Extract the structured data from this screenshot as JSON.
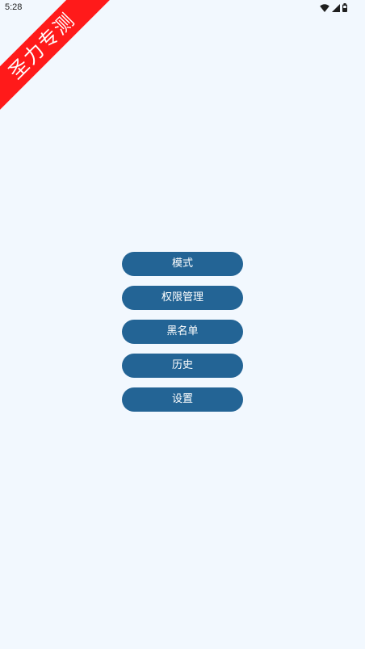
{
  "status_bar": {
    "time": "5:28",
    "icons": [
      "wifi-icon",
      "signal-icon",
      "battery-icon"
    ]
  },
  "ribbon": {
    "text": "圣力专测",
    "color": "#ff1a1a"
  },
  "menu": {
    "items": [
      {
        "label": "模式"
      },
      {
        "label": "权限管理"
      },
      {
        "label": "黑名单"
      },
      {
        "label": "历史"
      },
      {
        "label": "设置"
      }
    ]
  },
  "colors": {
    "background": "#f2f8fe",
    "button": "#236495",
    "button_text": "#ffffff"
  }
}
